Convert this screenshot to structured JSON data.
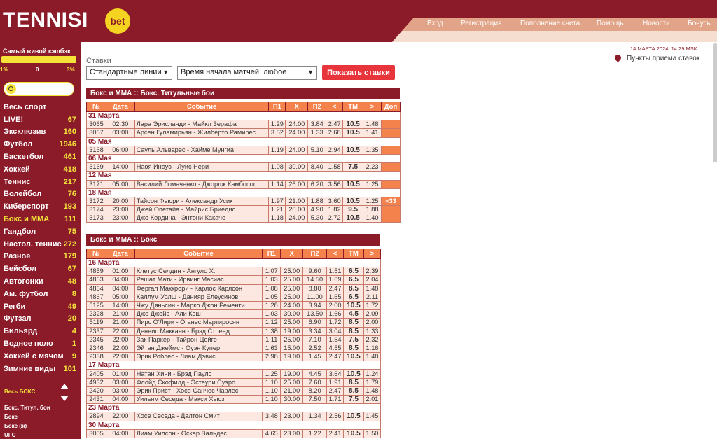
{
  "header": {
    "logo": "TENNISI",
    "logo_badge": "bet",
    "nav": [
      "Вход",
      "Регистрация",
      "Пополнение счета",
      "Помощь",
      "Новости",
      "Бонусы"
    ]
  },
  "sidebar": {
    "cashback_title": "Самый живой кэшбэк",
    "cashback_min": "1%",
    "cashback_mid": "0",
    "cashback_max": "3%",
    "sports": [
      {
        "label": "Весь спорт",
        "count": ""
      },
      {
        "label": "LIVE!",
        "count": "67"
      },
      {
        "label": "Эксклюзив",
        "count": "160"
      },
      {
        "label": "Футбол",
        "count": "1946"
      },
      {
        "label": "Баскетбол",
        "count": "461"
      },
      {
        "label": "Хоккей",
        "count": "418"
      },
      {
        "label": "Теннис",
        "count": "217"
      },
      {
        "label": "Волейбол",
        "count": "76"
      },
      {
        "label": "Киберспорт",
        "count": "193"
      },
      {
        "label": "Бокс и ММА",
        "count": "111"
      },
      {
        "label": "Гандбол",
        "count": "75"
      },
      {
        "label": "Настол. теннис",
        "count": "272"
      },
      {
        "label": "Разное",
        "count": "179"
      },
      {
        "label": "Бейсбол",
        "count": "67"
      },
      {
        "label": "Автогонки",
        "count": "48"
      },
      {
        "label": "Ам. футбол",
        "count": "8"
      },
      {
        "label": "Регби",
        "count": "49"
      },
      {
        "label": "Футзал",
        "count": "20"
      },
      {
        "label": "Бильярд",
        "count": "4"
      },
      {
        "label": "Водное поло",
        "count": "1"
      },
      {
        "label": "Хоккей с мячом",
        "count": "9"
      },
      {
        "label": "Зимние виды",
        "count": "101"
      }
    ],
    "sub_all": "Весь БОКС",
    "sub_items": [
      "Бокс. Титул. бои",
      "Бокс",
      "Бокс (ж)",
      "UFC"
    ]
  },
  "controls": {
    "label": "Ставки",
    "line_select": "Стандартные линии",
    "time_select": "Время начала матчей: любое",
    "show_button": "Показать ставки"
  },
  "info": {
    "datetime": "14 МАРТА 2024, 14:29 MSK",
    "points": "Пункты приема ставок"
  },
  "table_headers": [
    "№",
    "Дата",
    "Событие",
    "П1",
    "X",
    "П2",
    "<",
    "ТМ",
    ">",
    "Доп"
  ],
  "section1": {
    "title": "Бокс и ММА :: Бокс. Титульные бои",
    "groups": [
      {
        "date": "31 Марта",
        "rows": [
          [
            "3065",
            "02:30",
            "Лара Эрисланди - Майкл Зерафа",
            "1.29",
            "24.00",
            "3.84",
            "2.47",
            "10.5",
            "1.48",
            ""
          ],
          [
            "3067",
            "03:00",
            "Арсен Гуламирьян - Жилберто Рамирес",
            "3.52",
            "24.00",
            "1.33",
            "2.68",
            "10.5",
            "1.41",
            ""
          ]
        ]
      },
      {
        "date": "05 Мая",
        "rows": [
          [
            "3168",
            "06:00",
            "Сауль Альварес - Хайме Мунгиа",
            "1.19",
            "24.00",
            "5.10",
            "2.94",
            "10.5",
            "1.35",
            ""
          ]
        ]
      },
      {
        "date": "06 Мая",
        "rows": [
          [
            "3169",
            "14:00",
            "Наоя Иноуэ - Луис Нери",
            "1.08",
            "30.00",
            "8.40",
            "1.58",
            "7.5",
            "2.23",
            ""
          ]
        ]
      },
      {
        "date": "12 Мая",
        "rows": [
          [
            "3171",
            "05:00",
            "Василий Ломаченко - Джордж Камбосос",
            "1.14",
            "26.00",
            "6.20",
            "3.56",
            "10.5",
            "1.25",
            ""
          ]
        ]
      },
      {
        "date": "18 Мая",
        "rows": [
          [
            "3172",
            "20:00",
            "Тайсон Фьюри - Александр Усик",
            "1.97",
            "21.00",
            "1.88",
            "3.60",
            "10.5",
            "1.25",
            "+33"
          ],
          [
            "3174",
            "23:00",
            "Джей Опетайа - Майрис Бриедис",
            "1.21",
            "20.00",
            "4.90",
            "1.82",
            "9.5",
            "1.88",
            ""
          ],
          [
            "3173",
            "23:00",
            "Джо Кордина - Энтони Какаче",
            "1.18",
            "24.00",
            "5.30",
            "2.72",
            "10.5",
            "1.40",
            ""
          ]
        ]
      }
    ]
  },
  "section2": {
    "title": "Бокс и ММА :: Бокс",
    "groups": [
      {
        "date": "16 Марта",
        "rows": [
          [
            "4859",
            "01:00",
            "Клетус Селдин - Ангуло Х.",
            "1.07",
            "25.00",
            "9.60",
            "1.51",
            "6.5",
            "2.39"
          ],
          [
            "4863",
            "04:00",
            "Решат Мати - Ирвинг Масиас",
            "1.03",
            "25.00",
            "14.50",
            "1.69",
            "6.5",
            "2.04"
          ],
          [
            "4864",
            "04:00",
            "Фергал Маккрори - Карлос Карлсон",
            "1.08",
            "25.00",
            "8.80",
            "2.47",
            "8.5",
            "1.48"
          ],
          [
            "4867",
            "05:00",
            "Каллум Уолш - Данияр Елеусинов",
            "1.05",
            "25.00",
            "11.00",
            "1.65",
            "6.5",
            "2.11"
          ],
          [
            "5125",
            "14:00",
            "Чжу Дяньсин - Марко Джон Ременти",
            "1.28",
            "24.00",
            "3.94",
            "2.00",
            "10.5",
            "1.72"
          ],
          [
            "2328",
            "21:00",
            "Джо Джойс - Али Кэш",
            "1.03",
            "30.00",
            "13.50",
            "1.66",
            "4.5",
            "2.09"
          ],
          [
            "5119",
            "21:00",
            "Пирс О'Лири - Оганес Мартиросян",
            "1.12",
            "25.00",
            "6.90",
            "1.72",
            "8.5",
            "2.00"
          ],
          [
            "2337",
            "22:00",
            "Деннис Макканн - Брэд Стренд",
            "1.38",
            "19.00",
            "3.34",
            "3.04",
            "8.5",
            "1.33"
          ],
          [
            "2345",
            "22:00",
            "Зак Паркер - Тайрон Цойге",
            "1.11",
            "25.00",
            "7.10",
            "1.54",
            "7.5",
            "2.32"
          ],
          [
            "2346",
            "22:00",
            "Эйтан Джеймс - Оуэн Купер",
            "1.63",
            "15.00",
            "2.52",
            "4.55",
            "8.5",
            "1.16"
          ],
          [
            "2338",
            "22:00",
            "Эрик Роблес - Лиам Дэвис",
            "2.98",
            "19.00",
            "1.45",
            "2.47",
            "10.5",
            "1.48"
          ]
        ]
      },
      {
        "date": "17 Марта",
        "rows": [
          [
            "2405",
            "01:00",
            "Натан Хини - Брэд Паулс",
            "1.25",
            "19.00",
            "4.45",
            "3.64",
            "10.5",
            "1.24"
          ],
          [
            "4932",
            "03:00",
            "Флойд Скофилд - Эстеури Суэро",
            "1.10",
            "25.00",
            "7.60",
            "1.91",
            "8.5",
            "1.79"
          ],
          [
            "2420",
            "03:00",
            "Эрик Прист - Хосе Санчес Чарлес",
            "1.10",
            "21.00",
            "8.20",
            "2.47",
            "8.5",
            "1.48"
          ],
          [
            "2431",
            "04:00",
            "Уильям Сеседа - Макси Хьюз",
            "1.10",
            "30.00",
            "7.50",
            "1.71",
            "7.5",
            "2.01"
          ]
        ]
      },
      {
        "date": "23 Марта",
        "rows": [
          [
            "2894",
            "22:00",
            "Хосе Сеседа - Далтон Смит",
            "3.48",
            "23.00",
            "1.34",
            "2.56",
            "10.5",
            "1.45"
          ]
        ]
      },
      {
        "date": "30 Марта",
        "rows": [
          [
            "3005",
            "04:00",
            "Лиам Уилсон - Оскар Вальдес",
            "4.65",
            "23.00",
            "1.22",
            "2.41",
            "10.5",
            "1.50"
          ]
        ]
      }
    ]
  }
}
